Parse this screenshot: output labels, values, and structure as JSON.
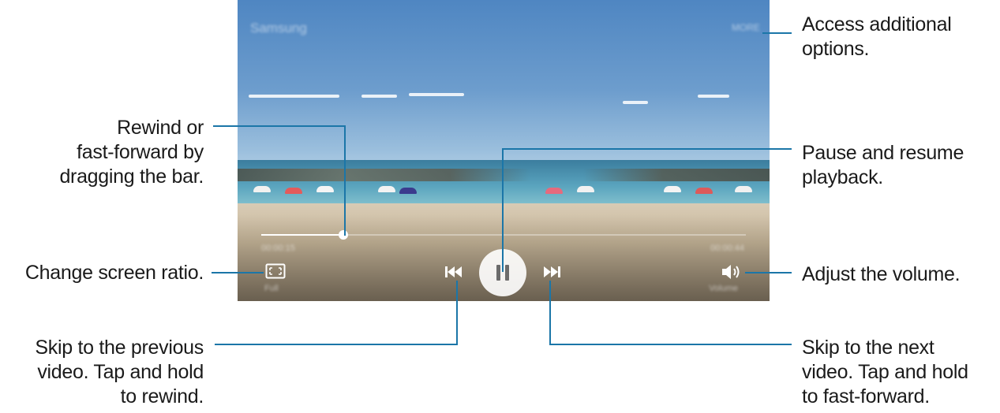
{
  "player": {
    "title": "Samsung",
    "more_label": "MORE",
    "elapsed_time": "00:00:15",
    "total_time": "00:00:44",
    "progress": 0.17,
    "ratio_label": "Full",
    "volume_label": "Volume"
  },
  "callouts": {
    "more": [
      "Access additional",
      "options."
    ],
    "seek": [
      "Rewind or",
      "fast-forward by",
      "dragging the bar."
    ],
    "pause": [
      "Pause and resume",
      "playback."
    ],
    "ratio": [
      "Change screen ratio."
    ],
    "volume": [
      "Adjust the volume."
    ],
    "prev": [
      "Skip to the previous",
      "video. Tap and hold",
      "to rewind."
    ],
    "next": [
      "Skip to the next",
      "video. Tap and hold",
      "to fast-forward."
    ]
  },
  "icons": {
    "ratio": "screen-ratio-icon",
    "prev": "previous-icon",
    "pause": "pause-icon",
    "next": "next-icon",
    "volume": "volume-icon"
  },
  "colors": {
    "callout_line": "#1b76a8",
    "sky": "#6d9dcd",
    "sea": "#5aa4be",
    "sand": "#c9b89b",
    "control": "#ffffff",
    "pause_glyph": "#6b6b6b"
  }
}
